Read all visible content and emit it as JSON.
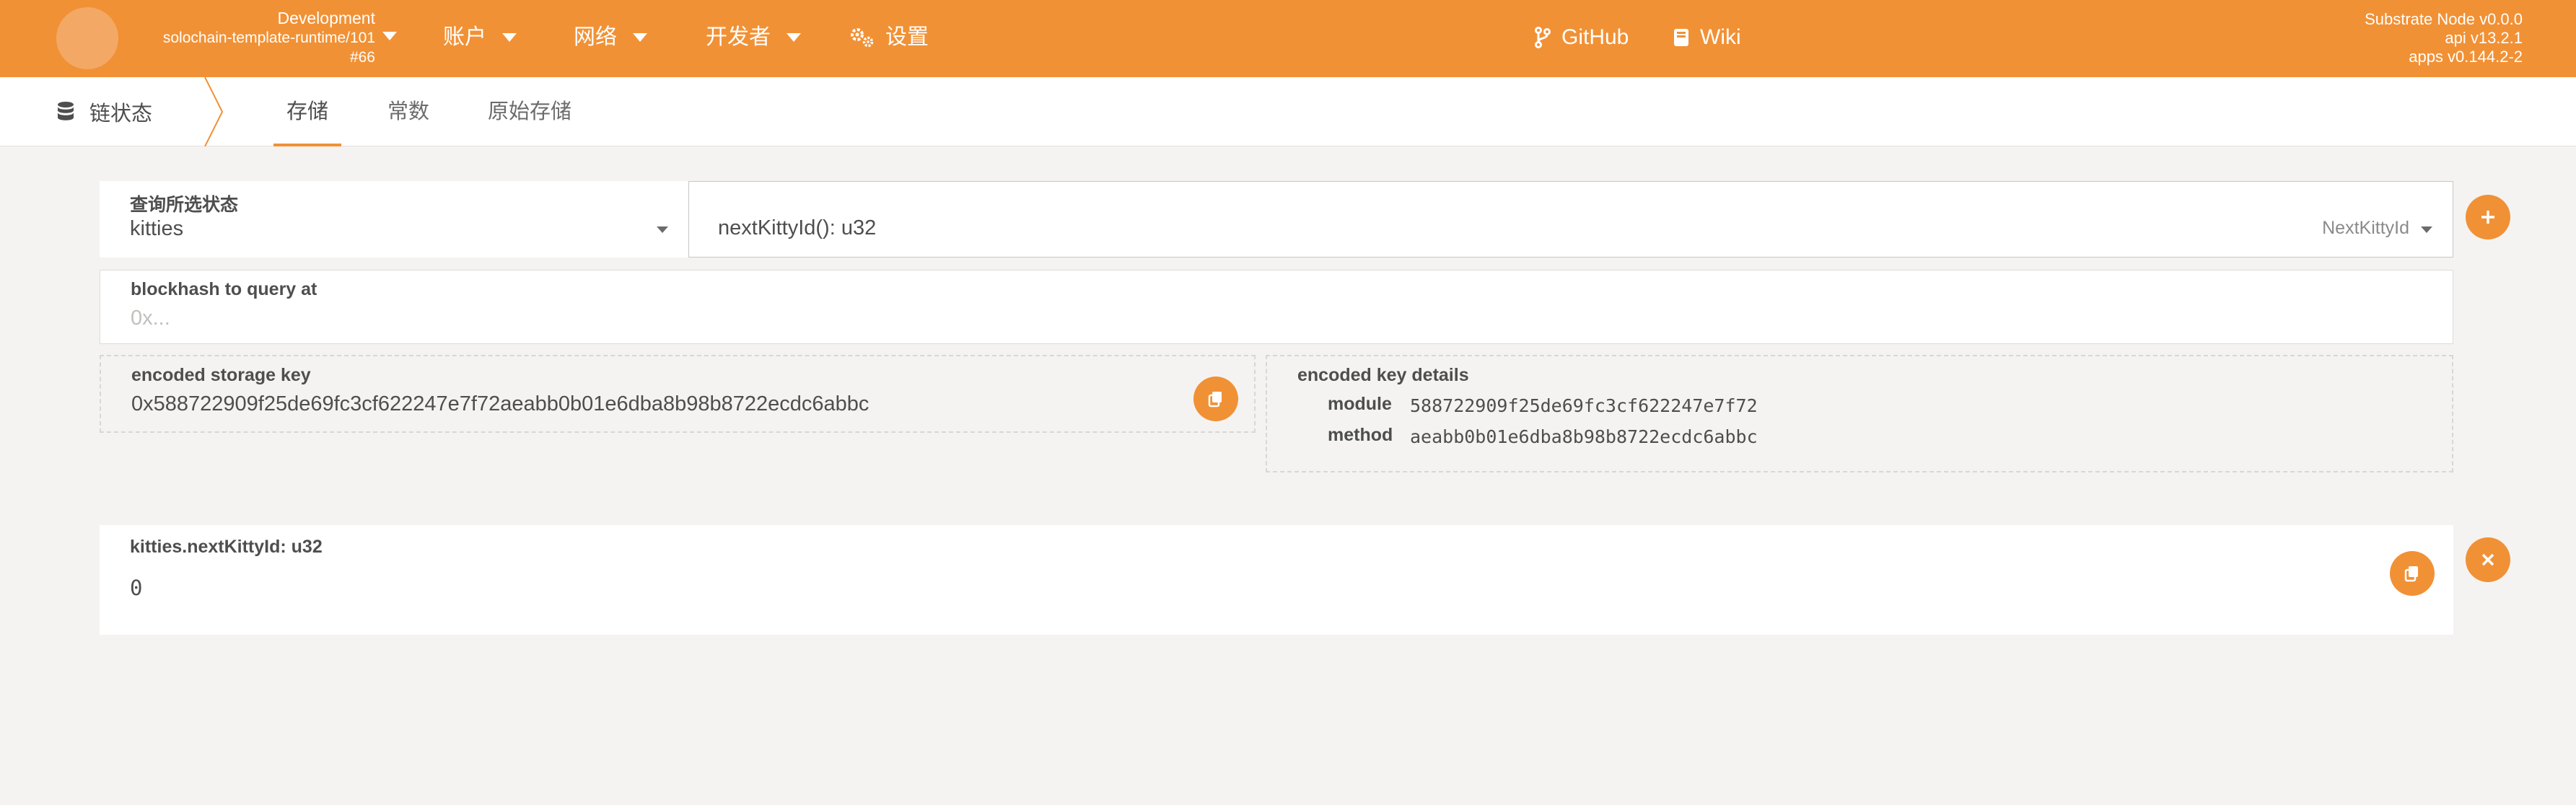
{
  "header": {
    "chain_name": "Development",
    "runtime": "solochain-template-runtime/101",
    "block": "#66",
    "nav": [
      {
        "label": "账户"
      },
      {
        "label": "网络"
      },
      {
        "label": "开发者"
      },
      {
        "label": "设置"
      }
    ],
    "links": [
      {
        "label": "GitHub"
      },
      {
        "label": "Wiki"
      }
    ],
    "node_name": "Substrate Node v0.0.0",
    "api_version": "api v13.2.1",
    "apps_version": "apps v0.144.2-2"
  },
  "tabs": {
    "section_title": "链状态",
    "items": [
      {
        "label": "存储",
        "active": true
      },
      {
        "label": "常数"
      },
      {
        "label": "原始存储"
      }
    ]
  },
  "query": {
    "label": "查询所选状态",
    "module": "kitties",
    "method_signature": "nextKittyId(): u32",
    "method_hint": "NextKittyId"
  },
  "blockhash": {
    "label": "blockhash to query at",
    "placeholder": "0x..."
  },
  "encoded_key": {
    "label": "encoded storage key",
    "value": "0x588722909f25de69fc3cf622247e7f72aeabb0b01e6dba8b98b8722ecdc6abbc"
  },
  "key_details": {
    "label": "encoded key details",
    "module_label": "module",
    "module_value": "588722909f25de69fc3cf622247e7f72",
    "method_label": "method",
    "method_value": "aeabb0b01e6dba8b98b8722ecdc6abbc"
  },
  "result": {
    "label": "kitties.nextKittyId: u32",
    "value": "0"
  },
  "colors": {
    "accent": "#f19135",
    "background": "#f4f3f2"
  }
}
